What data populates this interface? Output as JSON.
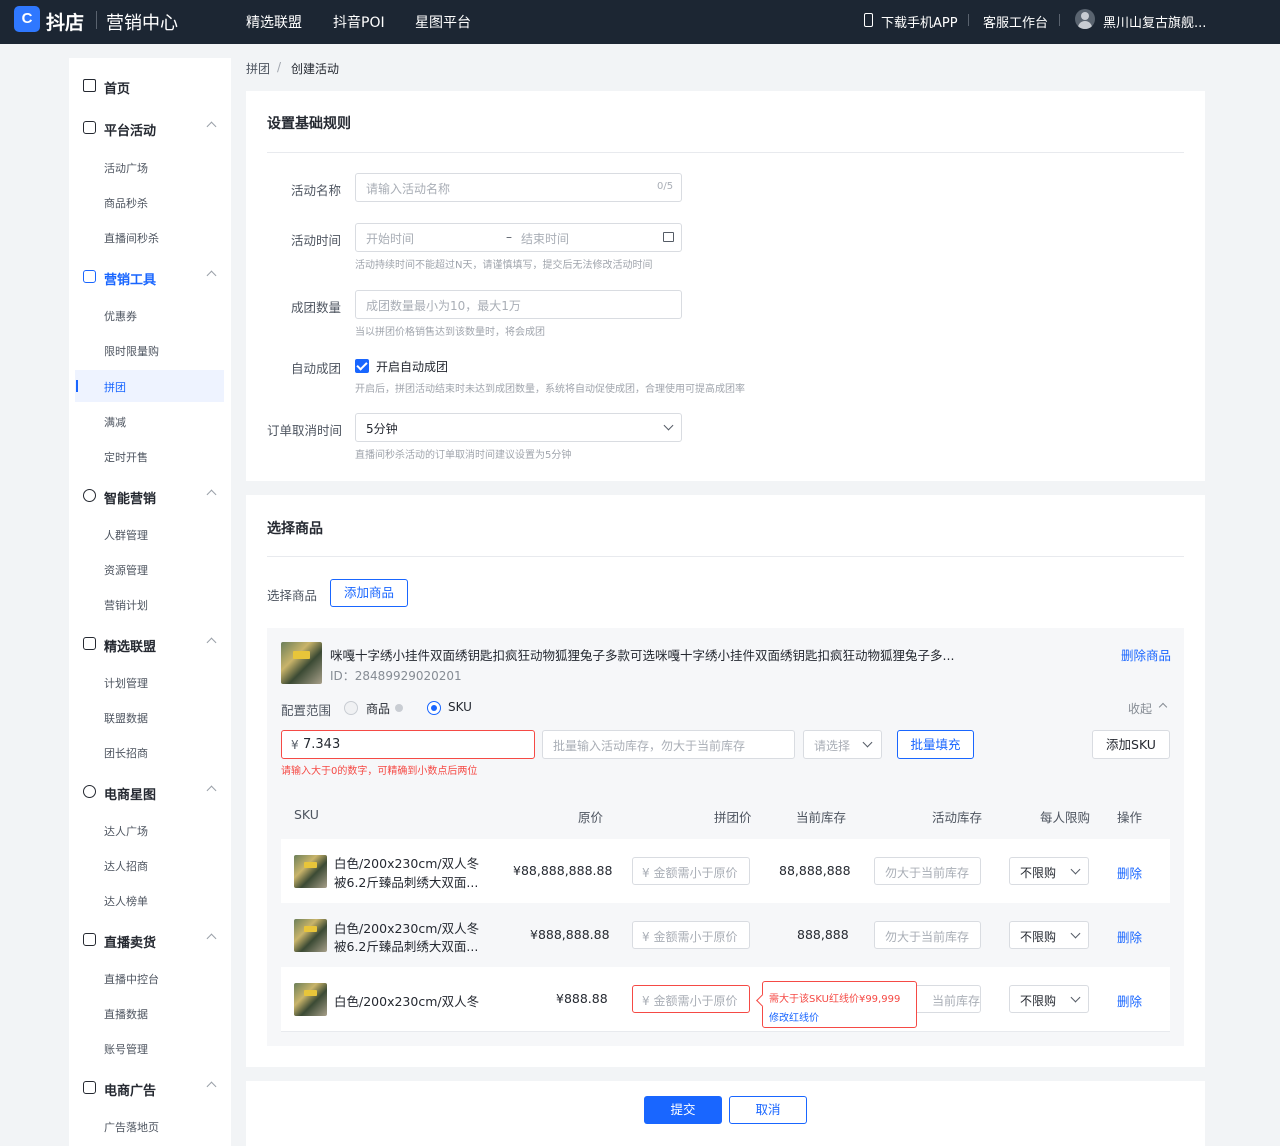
{
  "topbar": {
    "logo_mark": "C",
    "logo_text": "抖店",
    "logo_sub": "营销中心",
    "nav": [
      "精选联盟",
      "抖音POI",
      "星图平台"
    ],
    "download_app": "下载手机APP",
    "service": "客服工作台",
    "shop_name": "黑川山复古旗舰..."
  },
  "sidebar": {
    "home": "首页",
    "groups": [
      {
        "label": "平台活动",
        "items": [
          "活动广场",
          "商品秒杀",
          "直播间秒杀"
        ]
      },
      {
        "label": "营销工具",
        "items": [
          "优惠券",
          "限时限量购",
          "拼团",
          "满减",
          "定时开售"
        ]
      },
      {
        "label": "智能营销",
        "items": [
          "人群管理",
          "资源管理",
          "营销计划"
        ]
      },
      {
        "label": "精选联盟",
        "items": [
          "计划管理",
          "联盟数据",
          "团长招商"
        ]
      },
      {
        "label": "电商星图",
        "items": [
          "达人广场",
          "达人招商",
          "达人榜单"
        ]
      },
      {
        "label": "直播卖货",
        "items": [
          "直播中控台",
          "直播数据",
          "账号管理"
        ]
      },
      {
        "label": "电商广告",
        "items": [
          "广告落地页"
        ]
      }
    ]
  },
  "breadcrumb": {
    "parent": "拼团",
    "sep": "/",
    "current": "创建活动"
  },
  "basic": {
    "title": "设置基础规则",
    "name_label": "活动名称",
    "name_placeholder": "请输入活动名称",
    "name_count": "0/5",
    "time_label": "活动时间",
    "start_placeholder": "开始时间",
    "time_sep": "–",
    "end_placeholder": "结束时间",
    "time_hint": "活动持续时间不能超过N天，请谨慎填写，提交后无法修改活动时间",
    "qty_label": "成团数量",
    "qty_placeholder": "成团数量最小为10，最大1万",
    "qty_hint": "当以拼团价格销售达到该数量时，将会成团",
    "auto_label": "自动成团",
    "auto_checkbox": "开启自动成团",
    "auto_hint": "开启后，拼团活动结束时未达到成团数量，系统将自动促使成团，合理使用可提高成团率",
    "cancel_label": "订单取消时间",
    "cancel_value": "5分钟",
    "cancel_hint": "直播间秒杀活动的订单取消时间建议设置为5分钟"
  },
  "goods": {
    "title": "选择商品",
    "select_label": "选择商品",
    "add_button": "添加商品",
    "product_name": "咪嘎十字绣小挂件双面绣钥匙扣疯狂动物狐狸兔子多款可选咪嘎十字绣小挂件双面绣钥匙扣疯狂动物狐狸兔子多...",
    "product_id": "ID：28489929020201",
    "delete_product": "删除商品",
    "scope_label": "配置范围",
    "scope_goods": "商品",
    "scope_sku": "SKU",
    "collapse": "收起",
    "price_prefix": "¥",
    "price_value": "7.343",
    "stock_placeholder": "批量输入活动库存，勿大于当前库存",
    "select_placeholder": "请选择",
    "batch_fill": "批量填充",
    "add_sku": "添加SKU",
    "price_error": "请输入大于0的数字，可精确到小数点后两位",
    "columns": [
      "SKU",
      "原价",
      "拼团价",
      "当前库存",
      "活动库存",
      "每人限购",
      "操作"
    ],
    "rows": [
      {
        "sku_line1": "白色/200x230cm/双人冬",
        "sku_line2": "被6.2斤臻品刺绣大双面...",
        "price": "¥88,888,888.88",
        "group_price_placeholder": "¥ 金额需小于原价",
        "stock": "88,888,888",
        "act_stock_placeholder": "勿大于当前库存",
        "limit": "不限购",
        "action": "删除"
      },
      {
        "sku_line1": "白色/200x230cm/双人冬",
        "sku_line2": "被6.2斤臻品刺绣大双面...",
        "price": "¥888,888.88",
        "group_price_placeholder": "¥ 金额需小于原价",
        "stock": "888,888",
        "act_stock_placeholder": "勿大于当前库存",
        "limit": "不限购",
        "action": "删除"
      },
      {
        "sku_line1": "白色/200x230cm/双人冬",
        "sku_line2": "",
        "price": "¥888.88",
        "group_price_placeholder": "¥ 金额需小于原价",
        "stock": "",
        "act_stock_placeholder": "当前库存",
        "limit": "不限购",
        "action": "删除"
      }
    ],
    "tooltip_error": "需大于该SKU红线价¥99,999",
    "tooltip_link": "修改红线价"
  },
  "footer": {
    "submit": "提交",
    "cancel": "取消"
  },
  "colors": {
    "primary": "#1966ff",
    "error": "#f54a45",
    "topbar": "#1c2633"
  }
}
